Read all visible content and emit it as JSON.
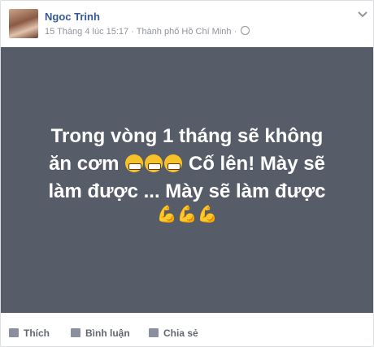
{
  "post": {
    "author": "Ngoc Trinh",
    "meta": "15 Tháng 4 lúc 15:17 · Thành phố Hồ Chí Minh ·",
    "text_line1": "Trong vòng 1 tháng sẽ không",
    "text_line2_a": "ăn cơm",
    "text_line2_b": "Cố lên! Mày sẽ",
    "text_line3": "làm được ... Mày sẽ làm được",
    "text_line4": "💪💪💪"
  },
  "actions": {
    "like": "Thích",
    "comment": "Bình luận",
    "share": "Chia sẻ"
  },
  "colors": {
    "post_bg": "#565d69",
    "name": "#365899"
  }
}
